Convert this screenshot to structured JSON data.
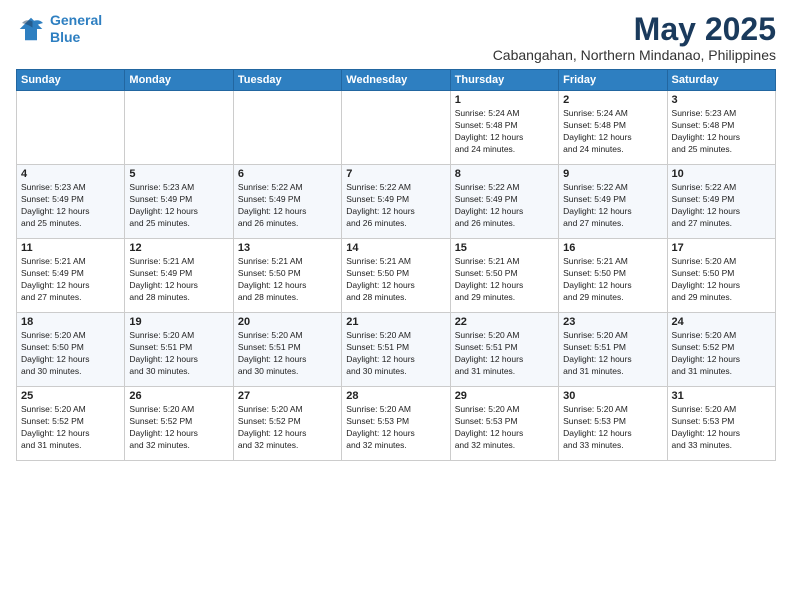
{
  "logo": {
    "line1": "General",
    "line2": "Blue"
  },
  "title": "May 2025",
  "location": "Cabangahan, Northern Mindanao, Philippines",
  "days_header": [
    "Sunday",
    "Monday",
    "Tuesday",
    "Wednesday",
    "Thursday",
    "Friday",
    "Saturday"
  ],
  "weeks": [
    [
      {
        "day": "",
        "info": ""
      },
      {
        "day": "",
        "info": ""
      },
      {
        "day": "",
        "info": ""
      },
      {
        "day": "",
        "info": ""
      },
      {
        "day": "1",
        "info": "Sunrise: 5:24 AM\nSunset: 5:48 PM\nDaylight: 12 hours\nand 24 minutes."
      },
      {
        "day": "2",
        "info": "Sunrise: 5:24 AM\nSunset: 5:48 PM\nDaylight: 12 hours\nand 24 minutes."
      },
      {
        "day": "3",
        "info": "Sunrise: 5:23 AM\nSunset: 5:48 PM\nDaylight: 12 hours\nand 25 minutes."
      }
    ],
    [
      {
        "day": "4",
        "info": "Sunrise: 5:23 AM\nSunset: 5:49 PM\nDaylight: 12 hours\nand 25 minutes."
      },
      {
        "day": "5",
        "info": "Sunrise: 5:23 AM\nSunset: 5:49 PM\nDaylight: 12 hours\nand 25 minutes."
      },
      {
        "day": "6",
        "info": "Sunrise: 5:22 AM\nSunset: 5:49 PM\nDaylight: 12 hours\nand 26 minutes."
      },
      {
        "day": "7",
        "info": "Sunrise: 5:22 AM\nSunset: 5:49 PM\nDaylight: 12 hours\nand 26 minutes."
      },
      {
        "day": "8",
        "info": "Sunrise: 5:22 AM\nSunset: 5:49 PM\nDaylight: 12 hours\nand 26 minutes."
      },
      {
        "day": "9",
        "info": "Sunrise: 5:22 AM\nSunset: 5:49 PM\nDaylight: 12 hours\nand 27 minutes."
      },
      {
        "day": "10",
        "info": "Sunrise: 5:22 AM\nSunset: 5:49 PM\nDaylight: 12 hours\nand 27 minutes."
      }
    ],
    [
      {
        "day": "11",
        "info": "Sunrise: 5:21 AM\nSunset: 5:49 PM\nDaylight: 12 hours\nand 27 minutes."
      },
      {
        "day": "12",
        "info": "Sunrise: 5:21 AM\nSunset: 5:49 PM\nDaylight: 12 hours\nand 28 minutes."
      },
      {
        "day": "13",
        "info": "Sunrise: 5:21 AM\nSunset: 5:50 PM\nDaylight: 12 hours\nand 28 minutes."
      },
      {
        "day": "14",
        "info": "Sunrise: 5:21 AM\nSunset: 5:50 PM\nDaylight: 12 hours\nand 28 minutes."
      },
      {
        "day": "15",
        "info": "Sunrise: 5:21 AM\nSunset: 5:50 PM\nDaylight: 12 hours\nand 29 minutes."
      },
      {
        "day": "16",
        "info": "Sunrise: 5:21 AM\nSunset: 5:50 PM\nDaylight: 12 hours\nand 29 minutes."
      },
      {
        "day": "17",
        "info": "Sunrise: 5:20 AM\nSunset: 5:50 PM\nDaylight: 12 hours\nand 29 minutes."
      }
    ],
    [
      {
        "day": "18",
        "info": "Sunrise: 5:20 AM\nSunset: 5:50 PM\nDaylight: 12 hours\nand 30 minutes."
      },
      {
        "day": "19",
        "info": "Sunrise: 5:20 AM\nSunset: 5:51 PM\nDaylight: 12 hours\nand 30 minutes."
      },
      {
        "day": "20",
        "info": "Sunrise: 5:20 AM\nSunset: 5:51 PM\nDaylight: 12 hours\nand 30 minutes."
      },
      {
        "day": "21",
        "info": "Sunrise: 5:20 AM\nSunset: 5:51 PM\nDaylight: 12 hours\nand 30 minutes."
      },
      {
        "day": "22",
        "info": "Sunrise: 5:20 AM\nSunset: 5:51 PM\nDaylight: 12 hours\nand 31 minutes."
      },
      {
        "day": "23",
        "info": "Sunrise: 5:20 AM\nSunset: 5:51 PM\nDaylight: 12 hours\nand 31 minutes."
      },
      {
        "day": "24",
        "info": "Sunrise: 5:20 AM\nSunset: 5:52 PM\nDaylight: 12 hours\nand 31 minutes."
      }
    ],
    [
      {
        "day": "25",
        "info": "Sunrise: 5:20 AM\nSunset: 5:52 PM\nDaylight: 12 hours\nand 31 minutes."
      },
      {
        "day": "26",
        "info": "Sunrise: 5:20 AM\nSunset: 5:52 PM\nDaylight: 12 hours\nand 32 minutes."
      },
      {
        "day": "27",
        "info": "Sunrise: 5:20 AM\nSunset: 5:52 PM\nDaylight: 12 hours\nand 32 minutes."
      },
      {
        "day": "28",
        "info": "Sunrise: 5:20 AM\nSunset: 5:53 PM\nDaylight: 12 hours\nand 32 minutes."
      },
      {
        "day": "29",
        "info": "Sunrise: 5:20 AM\nSunset: 5:53 PM\nDaylight: 12 hours\nand 32 minutes."
      },
      {
        "day": "30",
        "info": "Sunrise: 5:20 AM\nSunset: 5:53 PM\nDaylight: 12 hours\nand 33 minutes."
      },
      {
        "day": "31",
        "info": "Sunrise: 5:20 AM\nSunset: 5:53 PM\nDaylight: 12 hours\nand 33 minutes."
      }
    ]
  ]
}
